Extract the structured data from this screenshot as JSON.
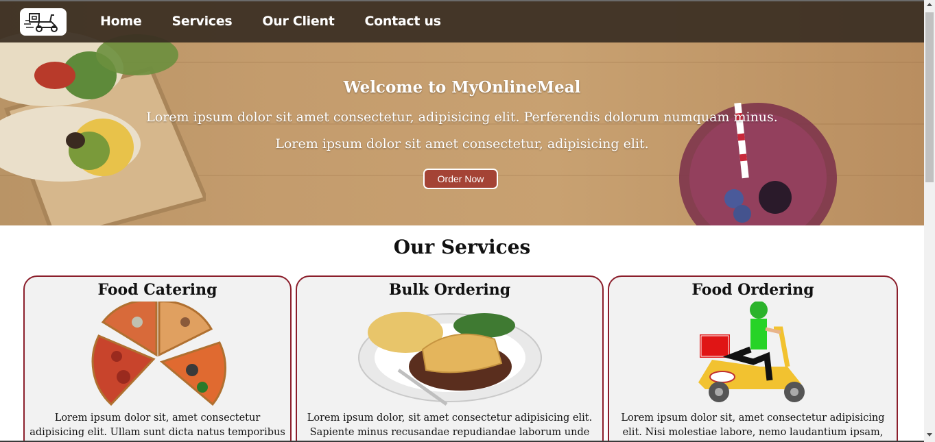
{
  "nav": {
    "logo": "delivery-scooter-logo",
    "links": [
      "Home",
      "Services",
      "Our Client",
      "Contact us"
    ]
  },
  "hero": {
    "title": "Welcome to MyOnlineMeal",
    "line1": "Lorem ipsum dolor sit amet consectetur, adipisicing elit. Perferendis dolorum numquam minus.",
    "line2": "Lorem ipsum dolor sit amet consectetur, adipisicing elit.",
    "button": "Order Now"
  },
  "services": {
    "title": "Our Services",
    "cards": [
      {
        "title": "Food Catering",
        "image": "pizza-slices-image",
        "text": "Lorem ipsum dolor sit, amet consectetur adipisicing elit. Ullam sunt dicta natus temporibus corrupti"
      },
      {
        "title": "Bulk Ordering",
        "image": "pie-and-potatoes-plate-image",
        "text": "Lorem ipsum dolor, sit amet consectetur adipisicing elit. Sapiente minus recusandae repudiandae laborum unde"
      },
      {
        "title": "Food Ordering",
        "image": "delivery-rider-scooter-image",
        "text": "Lorem ipsum dolor sit, amet consectetur adipisicing elit. Nisi molestiae labore, nemo laudantium ipsam, cupiditate"
      }
    ]
  },
  "colors": {
    "accent": "#a44335",
    "card_border": "#8b1e2b",
    "navbar": "#3a2e22",
    "card_bg": "#f2f2f2"
  }
}
